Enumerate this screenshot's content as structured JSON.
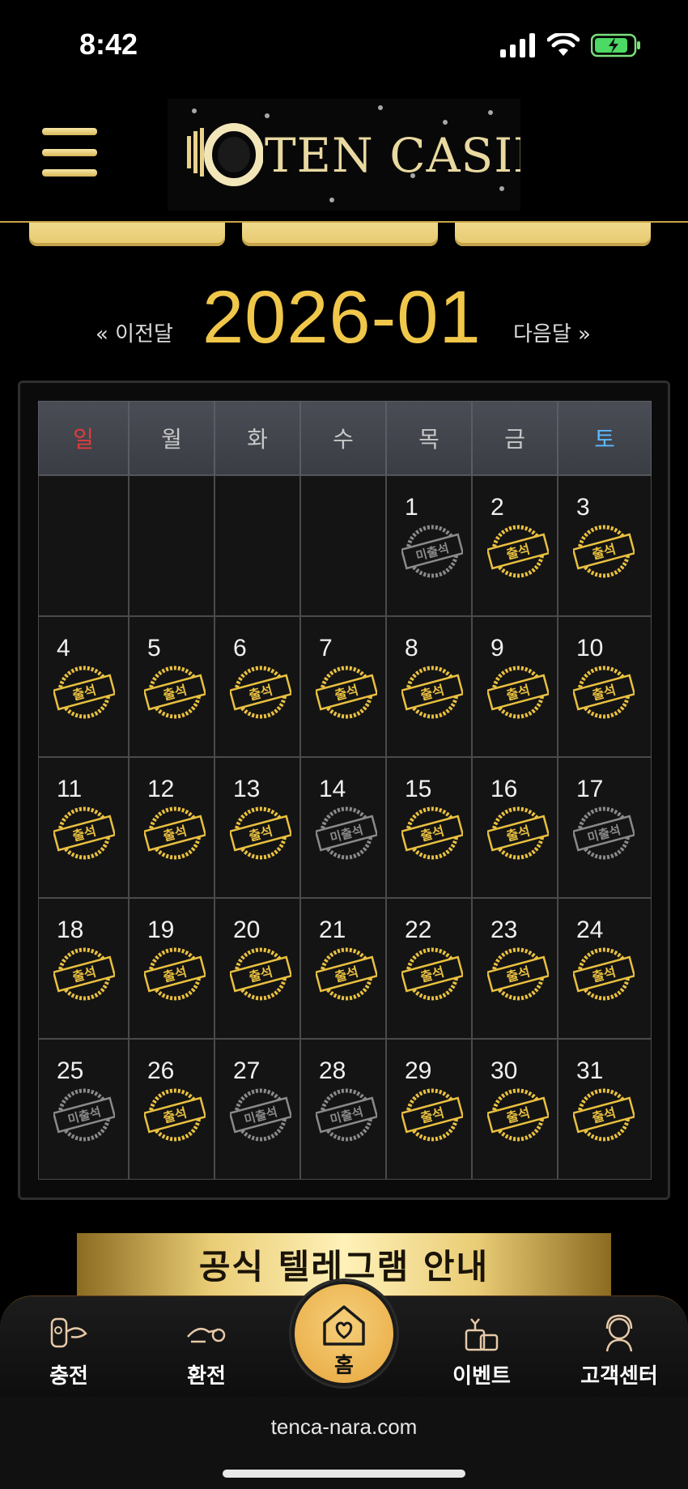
{
  "status_bar": {
    "time": "8:42"
  },
  "header": {
    "logo_text": "TEN CASINO"
  },
  "month_nav": {
    "prev_label": "« 이전달",
    "title": "2026-01",
    "next_label": "다음달 »"
  },
  "calendar": {
    "weekdays": [
      "일",
      "월",
      "화",
      "수",
      "목",
      "금",
      "토"
    ],
    "weeks": [
      [
        null,
        null,
        null,
        null,
        {
          "day": "1",
          "status": "absent"
        },
        {
          "day": "2",
          "status": "present"
        },
        {
          "day": "3",
          "status": "present"
        }
      ],
      [
        {
          "day": "4",
          "status": "present"
        },
        {
          "day": "5",
          "status": "present"
        },
        {
          "day": "6",
          "status": "present"
        },
        {
          "day": "7",
          "status": "present"
        },
        {
          "day": "8",
          "status": "present"
        },
        {
          "day": "9",
          "status": "present"
        },
        {
          "day": "10",
          "status": "present"
        }
      ],
      [
        {
          "day": "11",
          "status": "present"
        },
        {
          "day": "12",
          "status": "present"
        },
        {
          "day": "13",
          "status": "present"
        },
        {
          "day": "14",
          "status": "absent"
        },
        {
          "day": "15",
          "status": "present"
        },
        {
          "day": "16",
          "status": "present"
        },
        {
          "day": "17",
          "status": "absent"
        }
      ],
      [
        {
          "day": "18",
          "status": "present"
        },
        {
          "day": "19",
          "status": "present"
        },
        {
          "day": "20",
          "status": "present"
        },
        {
          "day": "21",
          "status": "present"
        },
        {
          "day": "22",
          "status": "present"
        },
        {
          "day": "23",
          "status": "present"
        },
        {
          "day": "24",
          "status": "present"
        }
      ],
      [
        {
          "day": "25",
          "status": "absent"
        },
        {
          "day": "26",
          "status": "present"
        },
        {
          "day": "27",
          "status": "absent"
        },
        {
          "day": "28",
          "status": "absent"
        },
        {
          "day": "29",
          "status": "present"
        },
        {
          "day": "30",
          "status": "present"
        },
        {
          "day": "31",
          "status": "present"
        }
      ]
    ],
    "stamp_present_label": "출석",
    "stamp_absent_label": "미출석"
  },
  "banner": {
    "text": "공식 텔레그램 안내"
  },
  "bottom_nav": {
    "items": [
      {
        "label": "충전",
        "icon": "deposit-icon"
      },
      {
        "label": "환전",
        "icon": "withdraw-icon"
      },
      {
        "label": "홈",
        "icon": "home-heart-icon"
      },
      {
        "label": "이벤트",
        "icon": "gift-icon"
      },
      {
        "label": "고객센터",
        "icon": "support-icon"
      }
    ]
  },
  "browser": {
    "url": "tenca-nara.com"
  },
  "colors": {
    "gold": "#f0c74a",
    "sunday": "#e23b3b",
    "saturday": "#5cb9ff"
  }
}
